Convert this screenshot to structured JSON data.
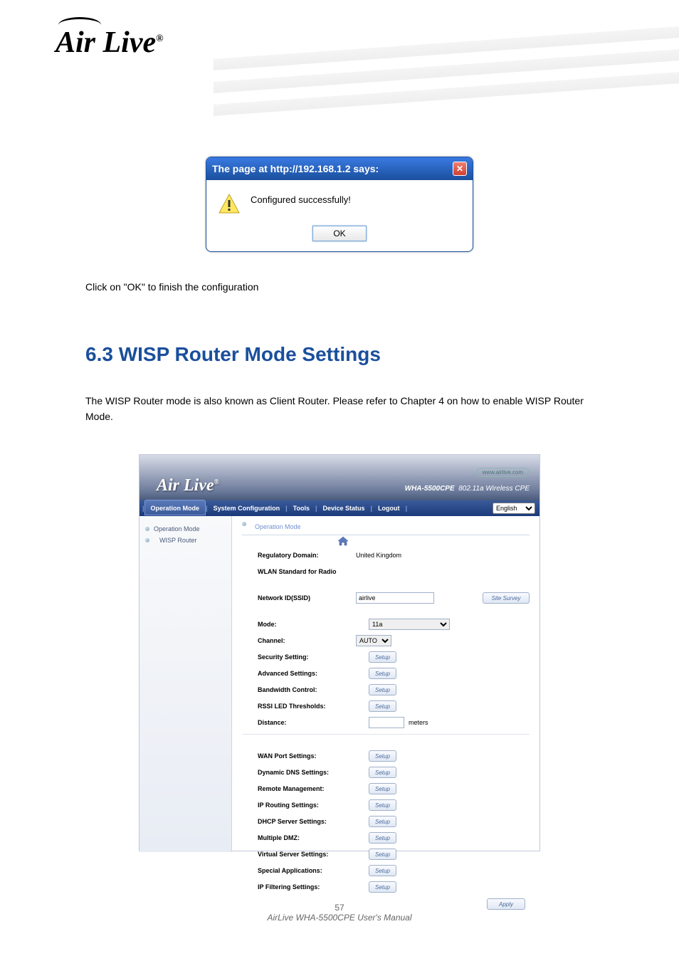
{
  "logo_text": "Air Live",
  "body_line_1": "Click on \"OK\" to finish the configuration",
  "section_heading": {
    "num": "6.3",
    "title": "WISP Router Mode Settings"
  },
  "body_line_2_a": "The WISP Router mode is also known as Client Router.",
  "body_line_2_b": "Please refer to Chapter 4 on how to enable WISP Router Mode.",
  "dialog": {
    "title": "The page at http://192.168.1.2 says:",
    "message": "Configured successfully!",
    "ok": "OK"
  },
  "admin": {
    "url": "www.airlive.com",
    "logo": "Air Live",
    "model": "WHA-5500CPE",
    "model_sub": "802.11a Wireless CPE",
    "nav": {
      "operation_mode": "Operation Mode",
      "system_config": "System Configuration",
      "tools": "Tools",
      "device_status": "Device Status",
      "logout": "Logout",
      "lang": "English"
    },
    "sidebar": {
      "op_mode": "Operation Mode",
      "wisp": "WISP Router"
    },
    "crumb": "Operation Mode",
    "labels": {
      "reg_domain": "Regulatory Domain:",
      "wlan_std": "WLAN Standard for Radio",
      "ssid": "Network ID(SSID)",
      "mode": "Mode:",
      "channel": "Channel:",
      "security": "Security Setting:",
      "advanced": "Advanced Settings:",
      "bandwidth": "Bandwidth Control:",
      "rssi": "RSSI LED Thresholds:",
      "distance": "Distance:",
      "wan": "WAN Port Settings:",
      "ddns": "Dynamic DNS Settings:",
      "remote": "Remote Management:",
      "iprouting": "IP Routing Settings:",
      "dhcp": "DHCP Server Settings:",
      "dmz": "Multiple DMZ:",
      "vserver": "Virtual Server Settings:",
      "spapp": "Special Applications:",
      "ipfilter": "IP Filtering Settings:"
    },
    "values": {
      "reg_domain": "United Kingdom",
      "ssid": "airlive",
      "mode": "11a",
      "channel": "AUTO",
      "distance_unit": "meters",
      "site_survey": "Site Survey",
      "setup": "Setup",
      "apply": "Apply"
    }
  },
  "footer": {
    "page": "57",
    "prod": "AirLive WHA-5500CPE User's Manual"
  }
}
